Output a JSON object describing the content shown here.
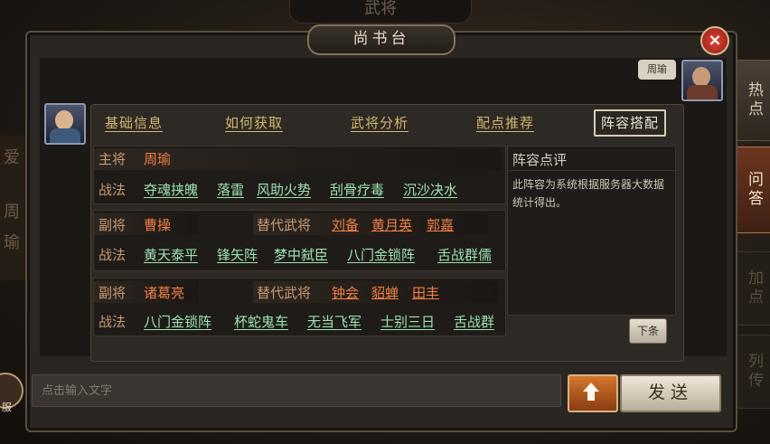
{
  "background": {
    "top_title": "武将",
    "left_chars": [
      "爱",
      "周",
      "瑜"
    ],
    "left_badge": "服"
  },
  "dialog": {
    "title": "尚书台",
    "close": "×"
  },
  "side_tabs": [
    "热点",
    "问答",
    "加点",
    "列传"
  ],
  "chat": {
    "bubble_name": "周瑜"
  },
  "tabs": [
    "基础信息",
    "如何获取",
    "武将分析",
    "配点推荐",
    "阵容搭配"
  ],
  "active_tab": "阵容搭配",
  "formation": {
    "main": {
      "label": "主将",
      "name": "周瑜",
      "tactic_label": "战法",
      "tactics": [
        "夺魂挟魄",
        "落雷",
        "风助火势",
        "刮骨疗毒",
        "沉沙决水"
      ]
    },
    "deputy1": {
      "label": "副将",
      "name": "曹操",
      "alt_label": "替代武将",
      "alts": [
        "刘备",
        "黄月英",
        "郭嘉"
      ],
      "tactic_label": "战法",
      "tactics": [
        "黄天泰平",
        "锋矢阵",
        "梦中弑臣",
        "八门金锁阵",
        "舌战群儒"
      ]
    },
    "deputy2": {
      "label": "副将",
      "name": "诸葛亮",
      "alt_label": "替代武将",
      "alts": [
        "钟会",
        "貂蝉",
        "田丰"
      ],
      "tactic_label": "战法",
      "tactics": [
        "八门金锁阵",
        "杯蛇鬼车",
        "无当飞军",
        "士别三日",
        "舌战群"
      ]
    }
  },
  "comment": {
    "title": "阵容点评",
    "text": "此阵容为系统根据服务器大数据统计得出。",
    "next_button": "下条"
  },
  "input": {
    "placeholder": "点击输入文字"
  },
  "send_button": "发送",
  "colors": {
    "tactic_green": "#9ee3b2",
    "name_orange": "#f07f45",
    "label_tan": "#c99b72"
  }
}
